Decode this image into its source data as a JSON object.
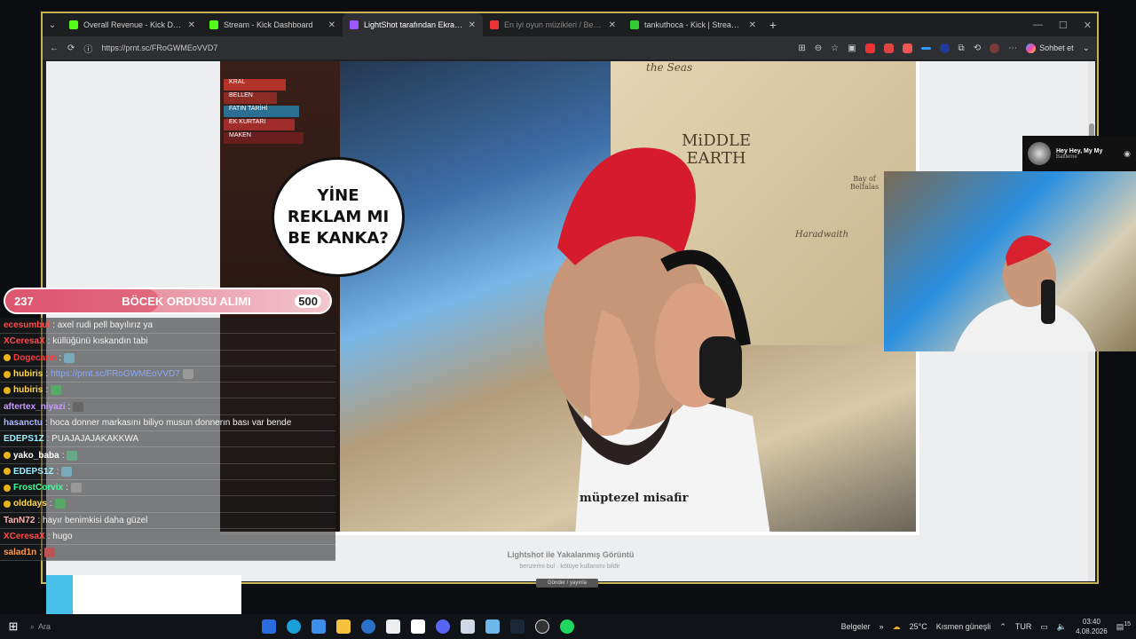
{
  "browser": {
    "tabs": [
      {
        "title": "Overall Revenue - Kick Dashboard",
        "favicon_color": "#53fc18",
        "active": false
      },
      {
        "title": "Stream - Kick Dashboard",
        "favicon_color": "#53fc18",
        "active": false
      },
      {
        "title": "LightShot tarafından Ekran Görünt",
        "favicon_color": "#9b59ff",
        "active": true
      },
      {
        "title": "En iyi oyun müzikleri / Best Game",
        "favicon_color": "#e33",
        "active": false
      },
      {
        "title": "tankuthoca - Kick | StreamerStats",
        "favicon_color": "#3c3",
        "active": false
      }
    ],
    "url": "https://prnt.sc/FRoGWMEoVVD7",
    "chat_button": "Sohbet et"
  },
  "screenshot": {
    "bubble_lines": [
      "YİNE",
      "REKLAM MI",
      "BE KANKA?"
    ],
    "map_title_lines": [
      "MiDDLE",
      "EARTH"
    ],
    "map_label_bay": "Bay of Belfalas",
    "map_label_harad": "Haradwaith",
    "map_label_seas": "the Seas",
    "shirt_text": "müptezel misafir",
    "books": [
      "KRAL",
      "BELLEN",
      "FATIN TARİHİ",
      "EK KURTARI",
      "MAKEN"
    ]
  },
  "page": {
    "caption": "Lightshot ile Yakalanmış Görüntü",
    "caption_links": [
      "benzerini bul",
      "kötüye kullanımı bildir"
    ],
    "send_button": "Gönder / yayınla"
  },
  "now_playing": {
    "song": "Hey Hey, My My",
    "artist": "Battleme"
  },
  "goal": {
    "current": "237",
    "name": "BÖCEK ORDUSU ALIMI",
    "target": "500",
    "progress": 0.474
  },
  "chat": [
    {
      "user": "ecesumbul",
      "color": "#ff4d4d",
      "text": ": axel rudi pell bayılırız ya"
    },
    {
      "user": "XCeresaX",
      "color": "#ff4d4d",
      "text": ": küllüğünü kıskandın tabi"
    },
    {
      "user": "Dogecann",
      "color": "#ff3b3b",
      "text": ":"
    },
    {
      "user": "hubiris",
      "color": "#ffd84d",
      "text": ":",
      "link": "https://prnt.sc/FRoGWMEoVVD7"
    },
    {
      "user": "hubiris",
      "color": "#ffd84d",
      "text": ":"
    },
    {
      "user": "aftertex_niyazi",
      "color": "#c79bff",
      "text": ":"
    },
    {
      "user": "hasanctu",
      "color": "#a9b8ff",
      "text": ": hoca donner markasını biliyo musun donnerın bası var bende"
    },
    {
      "user": "EDEPS1Z",
      "color": "#9ef0ff",
      "text": ": PUAJAJAJAKAKKWA"
    },
    {
      "user": "yako_baba",
      "color": "#ffffff",
      "text": ":"
    },
    {
      "user": "EDEPS1Z",
      "color": "#9ef0ff",
      "text": ":"
    },
    {
      "user": "FrostCorvix",
      "color": "#3dff9a",
      "text": ":"
    },
    {
      "user": "olddays",
      "color": "#ffd84d",
      "text": ":"
    },
    {
      "user": "TanN72",
      "color": "#ffb3b3",
      "text": ": hayır benimkisi daha güzel"
    },
    {
      "user": "XCeresaX",
      "color": "#ff4d4d",
      "text": ": hugo"
    },
    {
      "user": "salad1n",
      "color": "#ff9a4d",
      "text": ":"
    }
  ],
  "taskbar": {
    "search_placeholder": "Ara",
    "documents": "Belgeler",
    "weather_temp": "25°C",
    "weather_desc": "Kısmen güneşli",
    "lang": "TUR",
    "time": "03:40",
    "date": "4.08.2026",
    "notifications": "15"
  }
}
